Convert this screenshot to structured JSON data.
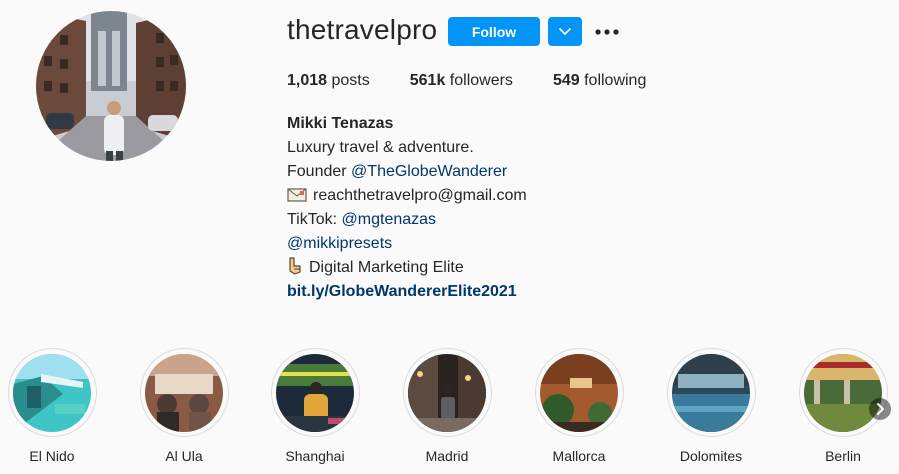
{
  "profile": {
    "username": "thetravelpro",
    "follow_label": "Follow",
    "dropdown_icon": "chevron-down-icon",
    "more_icon": "more-options-icon",
    "accent_color": "#0095f6",
    "link_color": "#00376b"
  },
  "stats": {
    "posts_count": "1,018",
    "posts_label": "posts",
    "followers_count": "561k",
    "followers_label": "followers",
    "following_count": "549",
    "following_label": "following"
  },
  "bio": {
    "full_name": "Mikki Tenazas",
    "line1": "Luxury travel & adventure.",
    "founder_prefix": "Founder",
    "founder_link": "@TheGlobeWanderer",
    "email_icon": "envelope-icon",
    "email": "reachthetravelpro@gmail.com",
    "tiktok_prefix": "TikTok:",
    "tiktok_link": "@mgtenazas",
    "presets_link": "@mikkipresets",
    "pointing_icon": "pointing-finger-icon",
    "elite_text": "Digital Marketing Elite",
    "website": "bit.ly/GlobeWandererElite2021"
  },
  "highlights": [
    {
      "label": "El Nido"
    },
    {
      "label": "Al Ula"
    },
    {
      "label": "Shanghai"
    },
    {
      "label": "Madrid"
    },
    {
      "label": "Mallorca"
    },
    {
      "label": "Dolomites"
    },
    {
      "label": "Berlin"
    }
  ],
  "highlights_next_icon": "chevron-right-icon"
}
